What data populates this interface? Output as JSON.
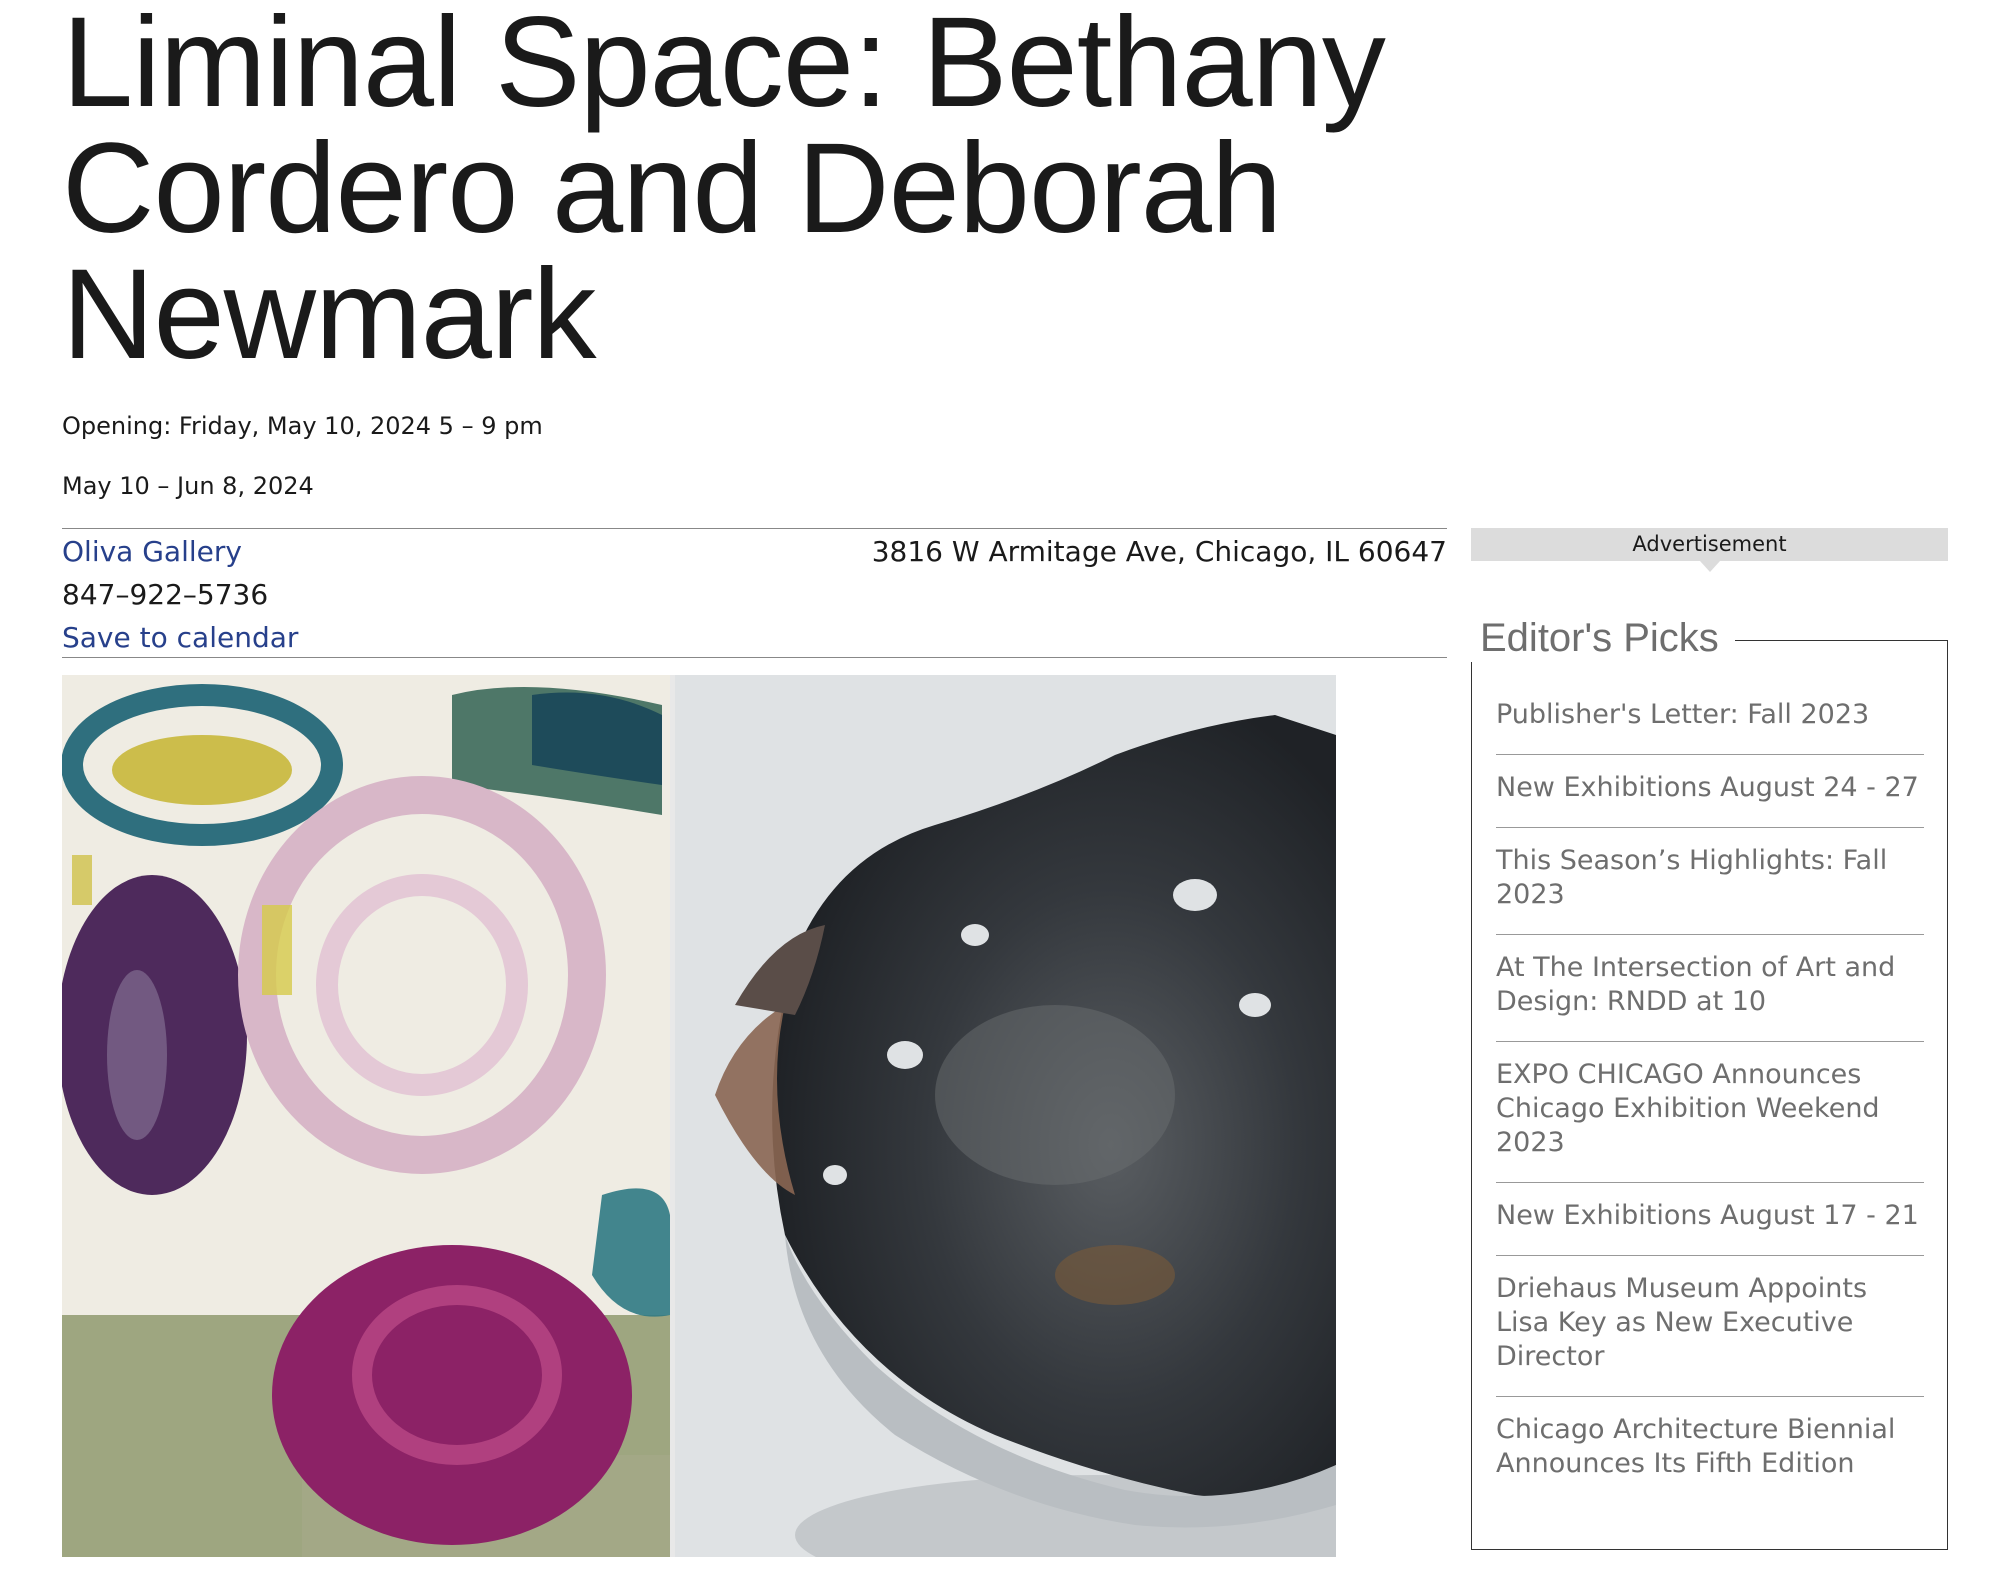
{
  "event": {
    "title": "Liminal Space: Bethany Cordero and Deborah Newmark",
    "opening": "Opening: Friday, May 10, 2024 5 – 9 pm",
    "dates": "May 10 – Jun 8, 2024"
  },
  "venue": {
    "gallery": "Oliva Gallery",
    "phone": "847–922–5736",
    "save_to_calendar": "Save to calendar",
    "address": "3816 W Armitage Ave, Chicago, IL 60647"
  },
  "sidebar": {
    "advertisement_label": "Advertisement",
    "editors_picks_title": "Editor's Picks",
    "picks": [
      "Publisher's Letter: Fall 2023",
      "New Exhibitions August 24 - 27",
      "This Season’s Highlights: Fall 2023",
      "At The Intersection of Art and Design: RNDD at 10",
      "EXPO CHICAGO Announces Chicago Exhibition Weekend 2023",
      "New Exhibitions August 17 - 21",
      "Driehaus Museum Appoints Lisa Key as New Executive Director",
      "Chicago Architecture Biennial Announces Its Fifth Edition"
    ]
  },
  "colors": {
    "link": "#27408b",
    "muted_text": "#6e6e6e",
    "ad_bar": "#dcdcdc"
  }
}
